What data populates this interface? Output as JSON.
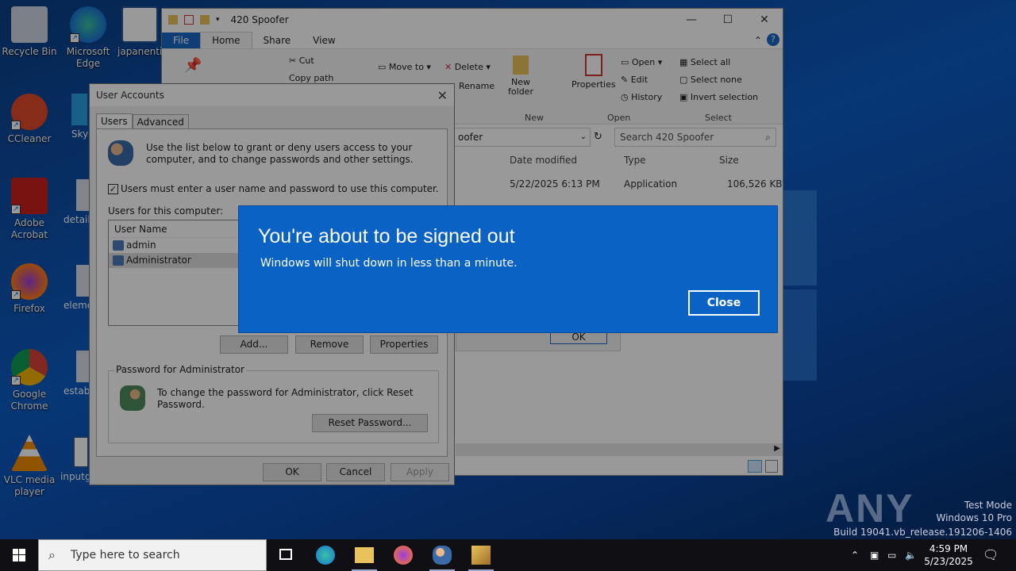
{
  "desktop": {
    "icons": [
      {
        "label": "Recycle Bin"
      },
      {
        "label": "Microsoft Edge"
      },
      {
        "label": "japanenti"
      },
      {
        "label": "CCleaner"
      },
      {
        "label": "Sky"
      },
      {
        "label": "Adobe Acrobat"
      },
      {
        "label": "details"
      },
      {
        "label": "Firefox"
      },
      {
        "label": "eleme"
      },
      {
        "label": "Google Chrome"
      },
      {
        "label": "establ"
      },
      {
        "label": "VLC media player"
      },
      {
        "label": "inputg"
      }
    ]
  },
  "explorer": {
    "title": "420 Spoofer",
    "tabs": {
      "file": "File",
      "home": "Home",
      "share": "Share",
      "view": "View"
    },
    "ribbon": {
      "cut": "Cut",
      "copy_path": "Copy path",
      "move_to": "Move to",
      "delete": "Delete",
      "rename": "Rename",
      "new_folder": "New folder",
      "new_group": "New",
      "properties": "Properties",
      "open": "Open",
      "edit": "Edit",
      "history": "History",
      "open_group": "Open",
      "select_all": "Select all",
      "select_none": "Select none",
      "invert_selection": "Invert selection",
      "select_group": "Select"
    },
    "address_tail": "oofer",
    "search_placeholder": "Search 420 Spoofer",
    "columns": {
      "date": "Date modified",
      "type": "Type",
      "size": "Size"
    },
    "row": {
      "date": "5/22/2025 6:13 PM",
      "type": "Application",
      "size": "106,526 KB"
    },
    "hidden_ok": "OK"
  },
  "user_accounts": {
    "title": "User Accounts",
    "tabs": {
      "users": "Users",
      "advanced": "Advanced"
    },
    "intro": "Use the list below to grant or deny users access to your computer, and to change passwords and other settings.",
    "must_login": "Users must enter a user name and password to use this computer.",
    "users_label": "Users for this computer:",
    "col_user": "User Name",
    "users": [
      "admin",
      "Administrator"
    ],
    "btn_add": "Add...",
    "btn_remove": "Remove",
    "btn_properties": "Properties",
    "pw_legend": "Password for Administrator",
    "pw_text": "To change the password for Administrator, click Reset Password.",
    "btn_reset": "Reset Password...",
    "btn_ok": "OK",
    "btn_cancel": "Cancel",
    "btn_apply": "Apply"
  },
  "signout": {
    "title": "You're about to be signed out",
    "message": "Windows will shut down in less than a minute.",
    "close": "Close"
  },
  "watermark": {
    "brand": "ANY RUN",
    "line1": "Test Mode",
    "line2": "Windows 10 Pro",
    "line3": "Build 19041.vb_release.191206-1406"
  },
  "taskbar": {
    "search_placeholder": "Type here to search",
    "time": "4:59 PM",
    "date": "5/23/2025"
  },
  "colors": {
    "accent": "#0a62c4",
    "taskbar": "#101014",
    "file_tab": "#1a67c4"
  }
}
